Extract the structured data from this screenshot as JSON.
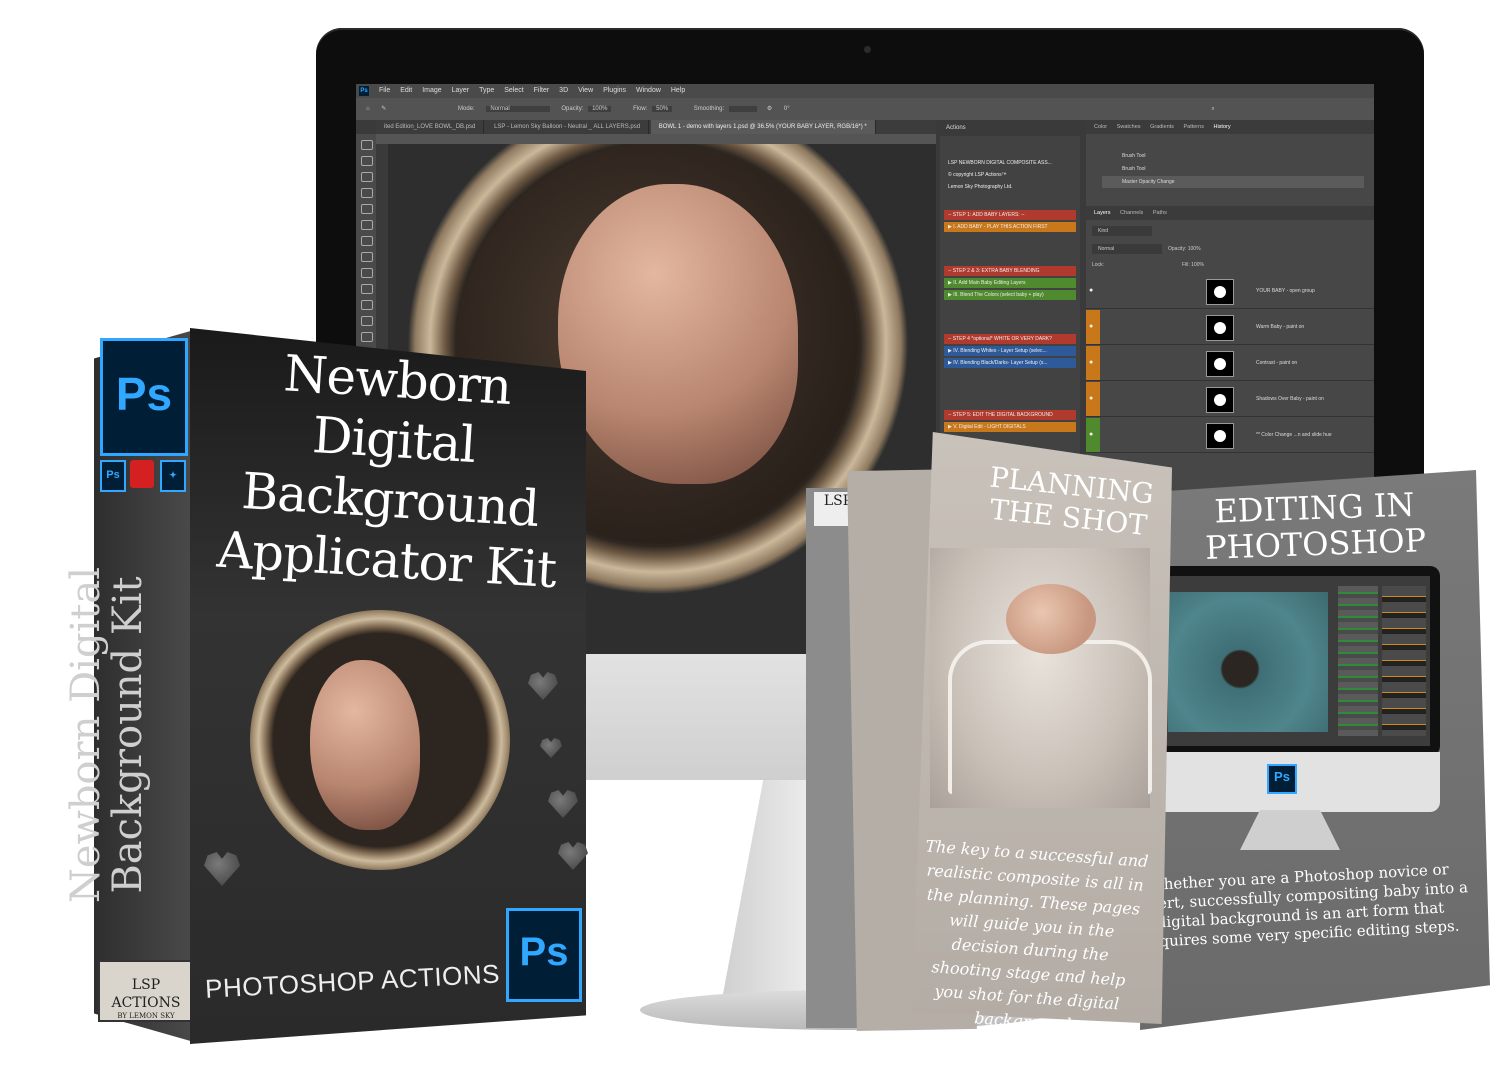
{
  "photoshop": {
    "logo": "Ps",
    "menu": [
      "File",
      "Edit",
      "Image",
      "Layer",
      "Type",
      "Select",
      "Filter",
      "3D",
      "View",
      "Plugins",
      "Window",
      "Help"
    ],
    "options": {
      "mode_label": "Mode:",
      "mode_value": "Normal",
      "opacity_label": "Opacity:",
      "opacity_value": "100%",
      "flow_label": "Flow:",
      "flow_value": "50%",
      "smoothing_label": "Smoothing:",
      "angle_value": "0°"
    },
    "tabs": [
      "ited Edition_LOVE BOWL_DB.psd",
      "LSP - Lemon Sky Balloon - Neutral _ ALL LAYERS.psd",
      "BOWL 1 - demo with layers 1.psd @ 36.5% (YOUR BABY LAYER, RGB/16*) *"
    ],
    "actions": {
      "title": "Actions",
      "items": [
        {
          "label": "LSP NEWBORN DIGITAL COMPOSITE ASS...",
          "color": "#424242"
        },
        {
          "label": "© copyright LSP Actions™",
          "color": "#424242"
        },
        {
          "label": "Lemon Sky Photography Ltd.",
          "color": "#424242"
        },
        {
          "label": "-- STEP 1: ADD BABY LAYERS: --",
          "color": "#b03a2e"
        },
        {
          "label": "▶ I. ADD BABY - PLAY THIS ACTION FIRST",
          "color": "#c8781a"
        },
        {
          "label": "-- STEP 2 & 3: EXTRA BABY BLENDING",
          "color": "#b03a2e"
        },
        {
          "label": "▶ II.  Add Main Baby Editing Layers",
          "color": "#4f8a2e"
        },
        {
          "label": "▶ III. Blend The Colors (select baby + play)",
          "color": "#4f8a2e"
        },
        {
          "label": "-- STEP 4 *optional* WHITE OR VERY DARK?",
          "color": "#b03a2e"
        },
        {
          "label": "▶ IV. Blending Whites - Layer Setup (selec...",
          "color": "#2e5a9a"
        },
        {
          "label": "▶ IV. Blending Black/Darks- Layer Setup (s...",
          "color": "#2e5a9a"
        },
        {
          "label": "-- STEP 5: EDIT THE DIGITAL BACKGROUND",
          "color": "#b03a2e"
        },
        {
          "label": "▶ V. Digital Edit - LIGHT DIGITALS",
          "color": "#c8781a"
        }
      ]
    },
    "history_tabs": [
      "Color",
      "Swatches",
      "Gradients",
      "Patterns",
      "History"
    ],
    "history_items": [
      "Brush Tool",
      "Brush Tool",
      "Master Opacity Change"
    ],
    "layers_tabs": [
      "Layers",
      "Channels",
      "Paths"
    ],
    "layers_filter": "Kind",
    "blend_mode": "Normal",
    "layers_opacity_label": "Opacity:",
    "layers_opacity": "100%",
    "lock_label": "Lock:",
    "fill_label": "Fill:",
    "fill_value": "100%",
    "layers": [
      {
        "name": "YOUR BABY - open group",
        "tag": "#474747"
      },
      {
        "name": "Warm Baby - paint on",
        "tag": "#c8781a"
      },
      {
        "name": "Contrast - paint on",
        "tag": "#c8781a"
      },
      {
        "name": "Shadows Over Baby - paint on",
        "tag": "#c8781a"
      },
      {
        "name": "** Color Change ...n and slide hue",
        "tag": "#4f8a2e"
      }
    ]
  },
  "box": {
    "title_line1": "Newborn Digital",
    "title_line2": "Background",
    "title_line3": "Applicator Kit",
    "spine_line1": "Newborn Digital",
    "spine_line2": "Background Kit",
    "footer": "PHOTOSHOP ACTIONS",
    "ps_badge": "Ps",
    "mini_ps_badge": "Ps",
    "logo_line1": "LSP ACTIONS",
    "logo_line2": "BY LEMON SKY"
  },
  "booklets": {
    "back_label": "LSP",
    "planning_title": "PLANNING THE SHOT",
    "planning_text": "The key to a successful and realistic composite is all in the planning. These pages will guide you in the decision during the shooting stage and help you shot for the digital background.",
    "editing_title": "EDITING IN PHOTOSHOP",
    "editing_text": "Whether you are a Photoshop novice or expert, successfully compositing baby into a digital background is an art form that requires some very specific editing steps.",
    "editing_ps_badge": "Ps"
  }
}
